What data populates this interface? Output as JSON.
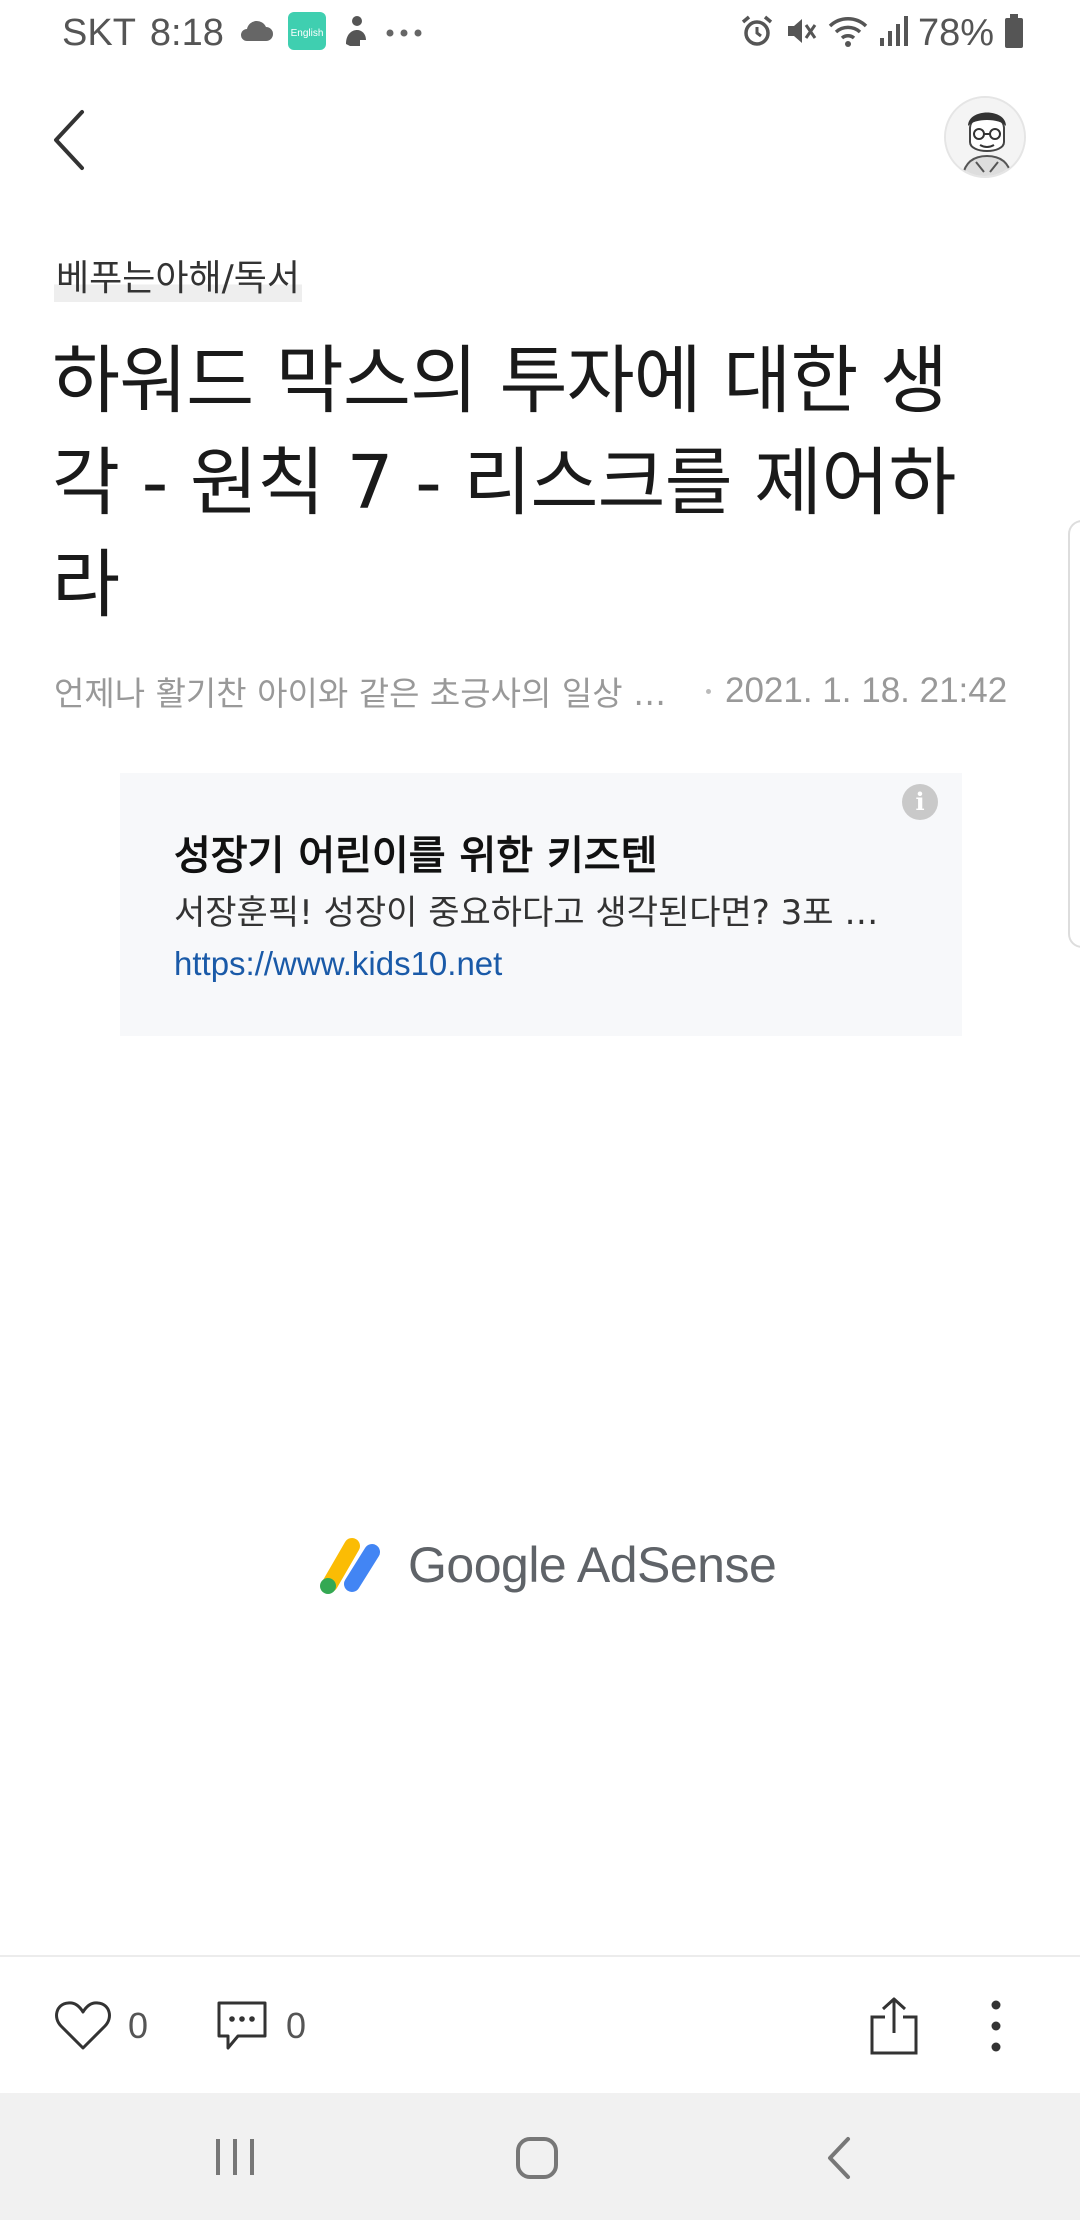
{
  "status_bar": {
    "carrier": "SKT",
    "time": "8:18",
    "english_badge": "English",
    "battery": "78%",
    "left_icons": [
      "cloud-icon",
      "english-keyboard-icon",
      "app-notification-icon",
      "more-dots-icon"
    ],
    "right_icons": [
      "alarm-icon",
      "mute-icon",
      "wifi-icon",
      "signal-icon",
      "battery-icon"
    ]
  },
  "nav": {
    "back_icon": "chevron-left-icon",
    "avatar": "profile-avatar"
  },
  "post": {
    "category": "베푸는아해/독서",
    "title": "하워드 막스의 투자에 대한 생각 - 원칙 7 - 리스크를 제어하라",
    "author": "언제나 활기찬 아이와 같은 초긍사의 일상 꿈꾸…",
    "date": "2021. 1. 18. 21:42"
  },
  "ad": {
    "info_label": "i",
    "headline": "성장기 어린이를 위한 키즈텐",
    "description": "서장훈픽! 성장이 중요하다고 생각된다면? 3포 …",
    "url": "https://www.kids10.net"
  },
  "adsense": {
    "logo_text": "Google AdSense",
    "colors": {
      "yellow": "#FBBC04",
      "blue": "#4285F4",
      "green": "#34A853"
    }
  },
  "actions": {
    "like_count": "0",
    "comment_count": "0",
    "icons": [
      "heart-icon",
      "comment-icon",
      "share-icon",
      "more-vertical-icon"
    ]
  },
  "system_nav": {
    "icons": [
      "recents-icon",
      "home-icon",
      "back-icon"
    ]
  },
  "colors": {
    "link": "#1a5aa8",
    "ad_background": "#f7f8fa",
    "nav_background": "#f1f1f1"
  }
}
